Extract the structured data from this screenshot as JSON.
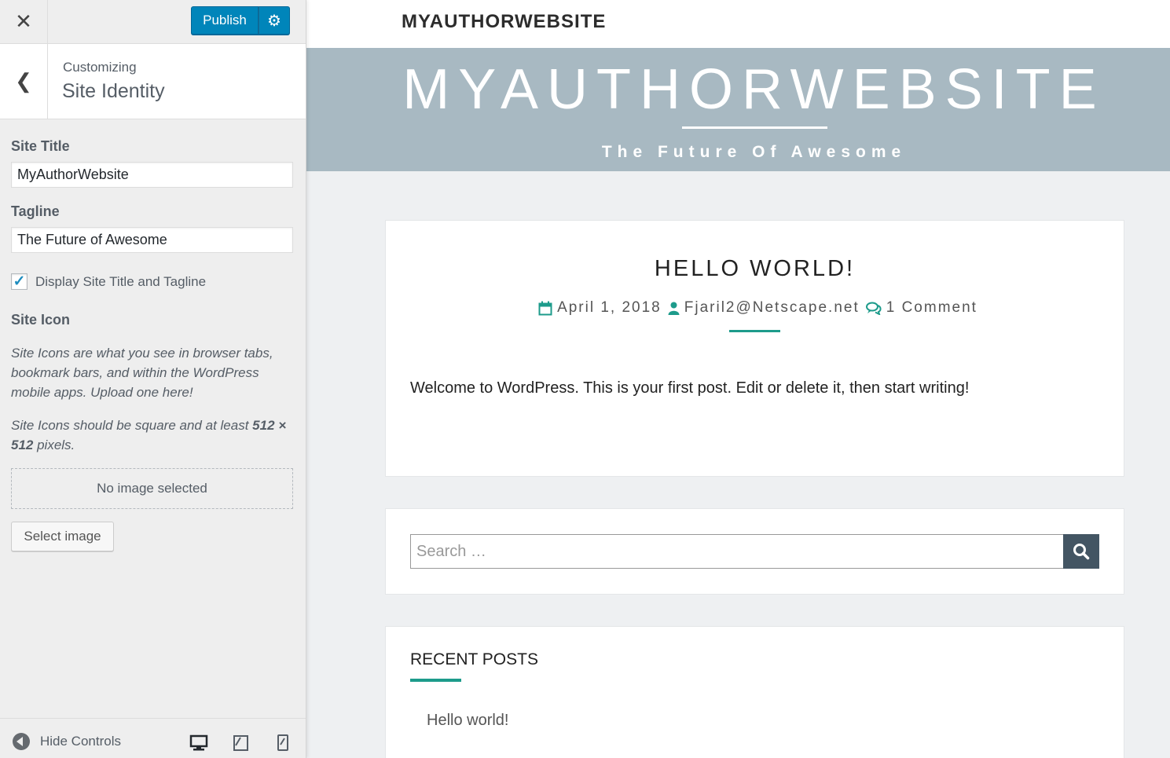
{
  "sidebar": {
    "close_glyph": "✕",
    "publish_label": "Publish",
    "gear_glyph": "⚙",
    "back_glyph": "❮",
    "breadcrumb": "Customizing",
    "section_title": "Site Identity",
    "site_title_label": "Site Title",
    "site_title_value": "MyAuthorWebsite",
    "tagline_label": "Tagline",
    "tagline_value": "The Future of Awesome",
    "display_checkbox_label": "Display Site Title and Tagline",
    "display_checkbox_checked": true,
    "site_icon_label": "Site Icon",
    "site_icon_desc": "Site Icons are what you see in browser tabs, bookmark bars, and within the WordPress mobile apps. Upload one here!",
    "site_icon_size_prefix": "Site Icons should be square and at least ",
    "site_icon_size_bold": "512 × 512",
    "site_icon_size_suffix": " pixels.",
    "no_image_text": "No image selected",
    "select_image_label": "Select image",
    "hide_controls_label": "Hide Controls",
    "device_icons": [
      "desktop-icon",
      "tablet-icon",
      "mobile-icon"
    ]
  },
  "preview": {
    "topbar_title": "MYAUTHORWEBSITE",
    "banner_title": "MYAUTHORWEBSITE",
    "banner_tagline": "The Future Of Awesome",
    "banner_color": "#a8b9c2",
    "post": {
      "title": "HELLO WORLD!",
      "date": "April 1, 2018",
      "author": "Fjaril2@Netscape.net",
      "comments": "1 Comment",
      "body": "Welcome to WordPress. This is your first post. Edit or delete it, then start writing!"
    },
    "search_placeholder": "Search …",
    "recent_posts_title": "RECENT POSTS",
    "recent_posts": [
      "Hello world!"
    ],
    "accent_color": "#1d9b8b"
  }
}
